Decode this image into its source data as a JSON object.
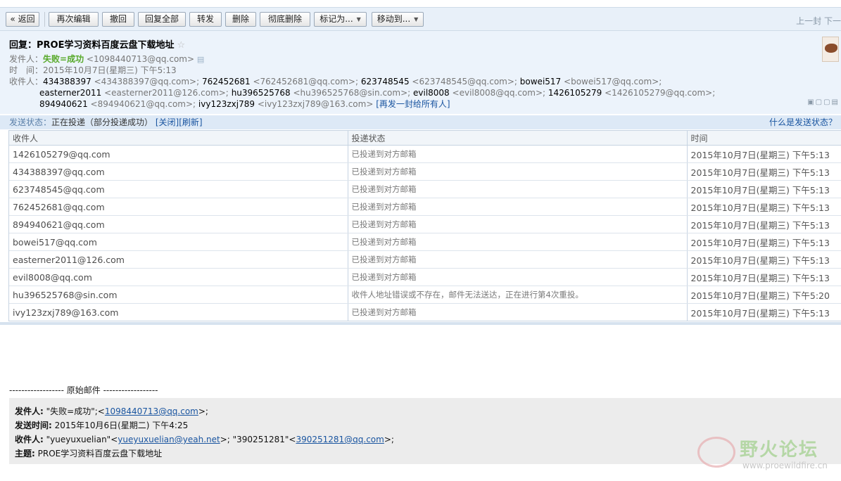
{
  "toolbar": {
    "back": "« 返回",
    "reedit": "再次编辑",
    "withdraw": "撤回",
    "reply_all": "回复全部",
    "forward": "转发",
    "delete": "删除",
    "delete_permanent": "彻底删除",
    "mark_as": "标记为...",
    "move_to": "移动到...",
    "nav_prev_next": "上一封 下一"
  },
  "mail": {
    "subject": "回复：PROE学习资料百度云盘下载地址",
    "sender_label": "发件人：",
    "sender_name": "失败=成功",
    "sender_addr": "<1098440713@qq.com>",
    "time_label": "时　间：",
    "time_value": "2015年10月7日(星期三) 下午5:13",
    "recipients_label": "收件人：",
    "recipients": [
      {
        "name": "434388397",
        "addr": "<434388397@qq.com>;"
      },
      {
        "name": "762452681",
        "addr": "<762452681@qq.com>;"
      },
      {
        "name": "623748545",
        "addr": "<623748545@qq.com>;"
      },
      {
        "name": "bowei517",
        "addr": "<bowei517@qq.com>;"
      },
      {
        "name": "easterner2011",
        "addr": "<easterner2011@126.com>;"
      },
      {
        "name": "hu396525768",
        "addr": "<hu396525768@sin.com>;"
      },
      {
        "name": "evil8008",
        "addr": "<evil8008@qq.com>;"
      },
      {
        "name": "1426105279",
        "addr": "<1426105279@qq.com>;"
      },
      {
        "name": "894940621",
        "addr": "<894940621@qq.com>;"
      },
      {
        "name": "ivy123zxj789",
        "addr": "<ivy123zxj789@163.com>"
      }
    ],
    "resend_all": "[再发一封给所有人]"
  },
  "status": {
    "label": "发送状态：",
    "value": "正在投递（部分投递成功）",
    "close": "[关闭]",
    "refresh": "[刷新]",
    "help": "什么是发送状态？"
  },
  "table": {
    "headers": [
      "收件人",
      "投递状态",
      "时间"
    ],
    "rows": [
      [
        "1426105279@qq.com",
        "已投递到对方邮箱",
        "2015年10月7日(星期三) 下午5:13"
      ],
      [
        "434388397@qq.com",
        "已投递到对方邮箱",
        "2015年10月7日(星期三) 下午5:13"
      ],
      [
        "623748545@qq.com",
        "已投递到对方邮箱",
        "2015年10月7日(星期三) 下午5:13"
      ],
      [
        "762452681@qq.com",
        "已投递到对方邮箱",
        "2015年10月7日(星期三) 下午5:13"
      ],
      [
        "894940621@qq.com",
        "已投递到对方邮箱",
        "2015年10月7日(星期三) 下午5:13"
      ],
      [
        "bowei517@qq.com",
        "已投递到对方邮箱",
        "2015年10月7日(星期三) 下午5:13"
      ],
      [
        "easterner2011@126.com",
        "已投递到对方邮箱",
        "2015年10月7日(星期三) 下午5:13"
      ],
      [
        "evil8008@qq.com",
        "已投递到对方邮箱",
        "2015年10月7日(星期三) 下午5:13"
      ],
      [
        "hu396525768@sin.com",
        "收件人地址错误或不存在，邮件无法送达，正在进行第4次重投。",
        "2015年10月7日(星期三) 下午5:20"
      ],
      [
        "ivy123zxj789@163.com",
        "已投递到对方邮箱",
        "2015年10月7日(星期三) 下午5:13"
      ]
    ]
  },
  "original": {
    "divider": "------------------ 原始邮件 ------------------",
    "from_label": "发件人:",
    "from_name": "\"失败=成功\";<",
    "from_email": "1098440713@qq.com",
    "from_tail": ">;",
    "sent_label": "发送时间:",
    "sent_value": "2015年10月6日(星期二) 下午4:25",
    "to_label": "收件人:",
    "to_name1": "\"yueyuxuelian\"<",
    "to_email1": "yueyuxuelian@yeah.net",
    "to_mid": ">; \"390251281\"<",
    "to_email2": "390251281@qq.com",
    "to_tail": ">;",
    "subject_label": "主题:",
    "subject_value": "PROE学习资料百度云盘下载地址"
  },
  "watermark": {
    "text": "野火论坛",
    "url": "www.proewildfire.cn"
  },
  "colors": {
    "toolbar_bg": "#e8f0f9",
    "header_bg": "#ecf3fb",
    "status_bg": "#dde9f6",
    "sender_green": "#57a92a",
    "link_blue": "#1a55a0"
  }
}
